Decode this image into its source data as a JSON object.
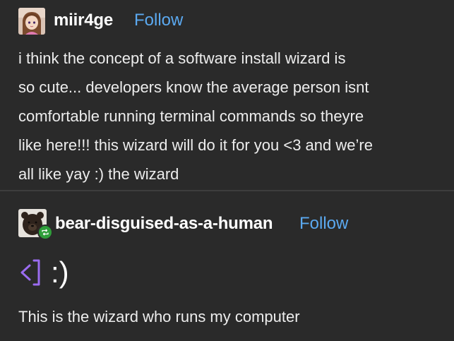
{
  "post1": {
    "username": "miir4ge",
    "follow_label": "Follow",
    "body": "i think the concept of a software install wizard is so cute... developers know the average person isnt comfortable running terminal commands so theyre like here!!! this wizard will do it for you <3 and we’re all like yay :) the wizard",
    "lines": [
      "i think the concept of a software install wizard is",
      "so cute... developers know the average person isnt",
      "comfortable running terminal commands so theyre",
      "like here!!! this wizard will do it for you <3 and we’re",
      "all like yay :) the wizard"
    ]
  },
  "post2": {
    "username": "bear-disguised-as-a-human",
    "follow_label": "Follow",
    "wizard_face": ":)",
    "body": "This is the wizard who runs my computer"
  },
  "colors": {
    "background": "#2a2a2a",
    "text": "#ededed",
    "follow": "#5ba9f0",
    "reblog_badge": "#2f9e3a",
    "terminal_icon": "#9b6cf0"
  },
  "icons": {
    "reblog": "reblog-icon",
    "terminal": "terminal-prompt-icon"
  }
}
